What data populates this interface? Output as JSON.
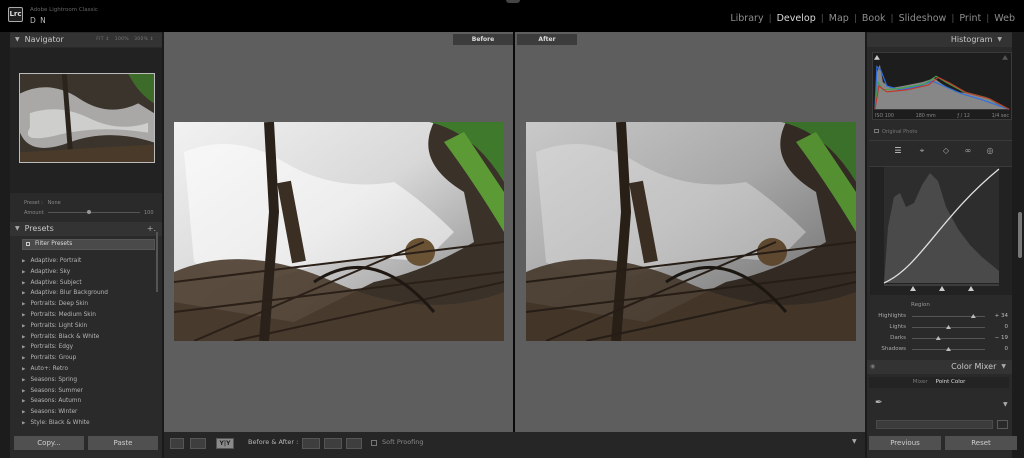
{
  "app": {
    "logo_text": "Lrc",
    "app_name": "Adobe Lightroom Classic",
    "user_name": "D N"
  },
  "modules": [
    "Library",
    "Develop",
    "Map",
    "Book",
    "Slideshow",
    "Print",
    "Web"
  ],
  "active_module": "Develop",
  "navigator": {
    "title": "Navigator",
    "zoom_options": [
      "FIT ↕",
      "100%",
      "300% ↕"
    ]
  },
  "preset_amount": {
    "reset_label": "Preset :",
    "reset_value": "None",
    "amount_label": "Amount",
    "amount_value": "100"
  },
  "presets": {
    "title": "Presets",
    "add_symbol": "+.",
    "filter_label": "Filter Presets",
    "items": [
      "Adaptive: Portrait",
      "Adaptive: Sky",
      "Adaptive: Subject",
      "Adaptive: Blur Background",
      "Portraits: Deep Skin",
      "Portraits: Medium Skin",
      "Portraits: Light Skin",
      "Portraits: Black & White",
      "Portraits: Edgy",
      "Portraits: Group",
      "Auto+: Retro",
      "Seasons: Spring",
      "Seasons: Summer",
      "Seasons: Autumn",
      "Seasons: Winter",
      "Style: Black & White"
    ]
  },
  "left_buttons": {
    "copy": "Copy...",
    "paste": "Paste"
  },
  "compare": {
    "before_label": "Before",
    "after_label": "After"
  },
  "toolbar": {
    "mode_label": "Before & After :",
    "soft_proofing": "Soft Proofing",
    "view_yy": "Y|Y"
  },
  "histogram": {
    "title": "Histogram",
    "iso": "ISO 100",
    "focal": "180 mm",
    "aperture": "ƒ / 12",
    "shutter": "1/4 sec",
    "original_photo": "Original Photo"
  },
  "tone_curve": {
    "region_label": "Region",
    "rows": [
      {
        "label": "Highlights",
        "value": "+ 34",
        "pos": 0.84
      },
      {
        "label": "Lights",
        "value": "0",
        "pos": 0.5
      },
      {
        "label": "Darks",
        "value": "− 19",
        "pos": 0.36
      },
      {
        "label": "Shadows",
        "value": "0",
        "pos": 0.5
      }
    ]
  },
  "color_mixer": {
    "title": "Color Mixer",
    "tab_mixer": "Mixer",
    "tab_point_color": "Point Color",
    "active_tab": "Point Color"
  },
  "right_buttons": {
    "previous": "Previous",
    "reset": "Reset"
  },
  "colors": {
    "background": "#5e5e5e",
    "panel": "#2a2a2a",
    "hist_blue": "#2f6fe0",
    "hist_green": "#3fa14a",
    "hist_red": "#c0392b"
  }
}
